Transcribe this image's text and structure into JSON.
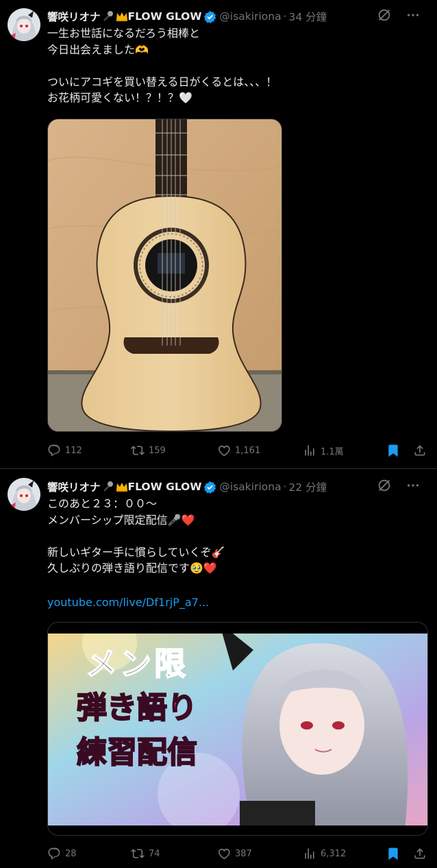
{
  "tweets": [
    {
      "display_name": "響咲リオナ",
      "name_suffix": "FLOW GLOW",
      "handle": "@isakiriona",
      "time": "34 分鐘",
      "text": "一生お世話になるだろう相棒と\n今日出会えました🫶\n\nついにアコギを買い替える日がくるとは、、、！\nお花柄可愛くない！？！？🤍",
      "media": "guitar-photo",
      "stats": {
        "replies": "112",
        "reposts": "159",
        "likes": "1,161",
        "views": "1.1萬"
      }
    },
    {
      "display_name": "響咲リオナ",
      "name_suffix": "FLOW GLOW",
      "handle": "@isakiriona",
      "time": "22 分鐘",
      "text": "このあと２３：００～\nメンバーシップ限定配信🎤❤️\n\n新しいギター手に慣らしていくぞ🎸\n久しぶりの弾き語り配信です🥹❤️",
      "link": "youtube.com/live/Df1rjP_a7...",
      "media": "stream-thumbnail",
      "thumbnail": {
        "line1": "メン限",
        "line2": "弾き語り",
        "line3": "練習配信"
      },
      "stats": {
        "replies": "28",
        "reposts": "74",
        "likes": "387",
        "views": "6,312"
      }
    }
  ],
  "colors": {
    "accent": "#1d9bf0",
    "muted": "#71767b",
    "divider": "#2f3336",
    "background": "#000000"
  }
}
